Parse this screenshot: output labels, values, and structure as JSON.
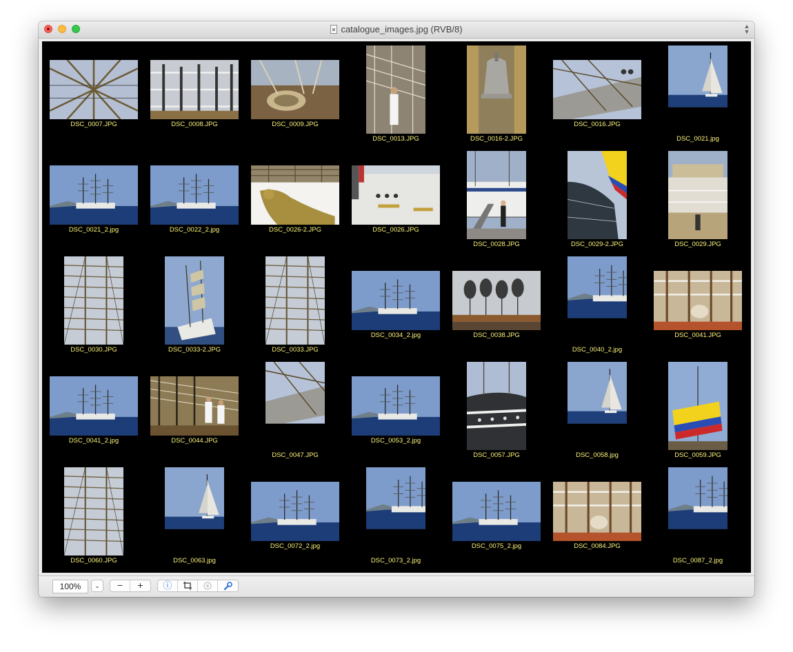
{
  "window": {
    "title": "catalogue_images.jpg (RVB/8)",
    "buttons": [
      "close",
      "minimize",
      "zoom"
    ]
  },
  "colors": {
    "canvas_background": "#000000",
    "filename_label": "#fdf47a",
    "window_chrome": "#ececec",
    "accent": "#3a7bd5"
  },
  "contact_sheet": {
    "rows": 5,
    "columns": 7,
    "thumbnails": [
      {
        "label": "DSC_0007.JPG",
        "orientation": "landscape",
        "scene": "rigging"
      },
      {
        "label": "DSC_0008.JPG",
        "orientation": "landscape",
        "scene": "rails"
      },
      {
        "label": "DSC_0009.JPG",
        "orientation": "landscape",
        "scene": "ropes"
      },
      {
        "label": "DSC_0013.JPG",
        "orientation": "portrait",
        "scene": "sailor"
      },
      {
        "label": "DSC_0016-2.JPG",
        "orientation": "portrait",
        "scene": "bell"
      },
      {
        "label": "DSC_0016.JPG",
        "orientation": "landscape",
        "scene": "bow"
      },
      {
        "label": "DSC_0021.jpg",
        "orientation": "portrait",
        "scene": "sail-boat"
      },
      {
        "label": "DSC_0021_2.jpg",
        "orientation": "landscape",
        "scene": "ship-sea"
      },
      {
        "label": "DSC_0022_2.jpg",
        "orientation": "landscape",
        "scene": "ship-sea"
      },
      {
        "label": "DSC_0026-2.JPG",
        "orientation": "landscape",
        "scene": "figurehead"
      },
      {
        "label": "DSC_0026.JPG",
        "orientation": "landscape",
        "scene": "hull-name"
      },
      {
        "label": "DSC_0028.JPG",
        "orientation": "portrait",
        "scene": "gangway"
      },
      {
        "label": "DSC_0029-2.JPG",
        "orientation": "portrait",
        "scene": "flag-hull"
      },
      {
        "label": "DSC_0029.JPG",
        "orientation": "portrait",
        "scene": "bridge"
      },
      {
        "label": "DSC_0030.JPG",
        "orientation": "portrait",
        "scene": "masts"
      },
      {
        "label": "DSC_0033-2.JPG",
        "orientation": "portrait",
        "scene": "ship-port"
      },
      {
        "label": "DSC_0033.JPG",
        "orientation": "portrait",
        "scene": "masts"
      },
      {
        "label": "DSC_0034_2.jpg",
        "orientation": "landscape",
        "scene": "ship-sea"
      },
      {
        "label": "DSC_0038.JPG",
        "orientation": "landscape",
        "scene": "pulleys"
      },
      {
        "label": "DSC_0040_2.jpg",
        "orientation": "portrait",
        "scene": "ship-sea"
      },
      {
        "label": "DSC_0041.JPG",
        "orientation": "landscape",
        "scene": "deck"
      },
      {
        "label": "DSC_0041_2.jpg",
        "orientation": "landscape",
        "scene": "ship-sea"
      },
      {
        "label": "DSC_0044.JPG",
        "orientation": "landscape",
        "scene": "sailors"
      },
      {
        "label": "DSC_0047.JPG",
        "orientation": "portrait",
        "scene": "bow"
      },
      {
        "label": "DSC_0053_2.jpg",
        "orientation": "landscape",
        "scene": "ship-sea"
      },
      {
        "label": "DSC_0057.JPG",
        "orientation": "portrait",
        "scene": "hull"
      },
      {
        "label": "DSC_0058.jpg",
        "orientation": "portrait",
        "scene": "sail-boat"
      },
      {
        "label": "DSC_0059.JPG",
        "orientation": "portrait",
        "scene": "flag"
      },
      {
        "label": "DSC_0060.JPG",
        "orientation": "portrait",
        "scene": "masts"
      },
      {
        "label": "DSC_0063.jpg",
        "orientation": "portrait",
        "scene": "sail-boat"
      },
      {
        "label": "DSC_0072_2.jpg",
        "orientation": "landscape",
        "scene": "ship-sea"
      },
      {
        "label": "DSC_0073_2.jpg",
        "orientation": "portrait",
        "scene": "ship-sea"
      },
      {
        "label": "DSC_0075_2.jpg",
        "orientation": "landscape",
        "scene": "ship-sea"
      },
      {
        "label": "DSC_0084.JPG",
        "orientation": "landscape",
        "scene": "deck"
      },
      {
        "label": "DSC_0087_2.jpg",
        "orientation": "portrait",
        "scene": "ship-sea"
      }
    ]
  },
  "toolbar": {
    "zoom_value": "100%",
    "zoom_dropdown_icon": "chevron-down-icon",
    "zoom_out": "−",
    "zoom_in": "+",
    "info_icon": "info-icon",
    "crop_icon": "crop-icon",
    "color_icon": "color-wheel-icon",
    "tools_icon": "wrench-icon"
  }
}
